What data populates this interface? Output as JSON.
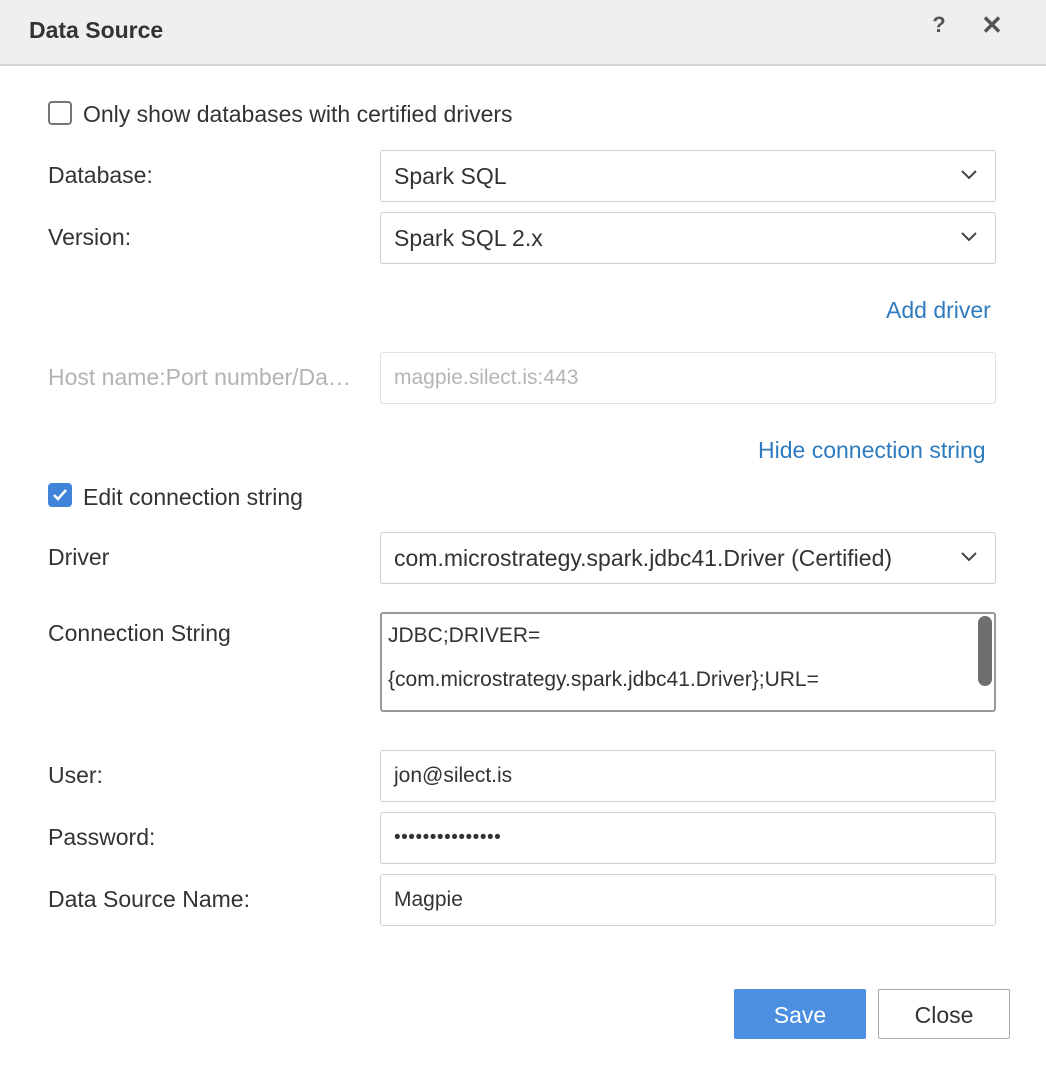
{
  "dialog": {
    "title": "Data Source"
  },
  "certified_only": {
    "label": "Only show databases with certified drivers",
    "checked": false
  },
  "database": {
    "label": "Database:",
    "value": "Spark SQL"
  },
  "version": {
    "label": "Version:",
    "value": "Spark SQL 2.x"
  },
  "add_driver_link": "Add driver",
  "host": {
    "label": "Host name:Port number/Da…",
    "placeholder": "magpie.silect.is:443"
  },
  "hide_connection_link": "Hide connection string",
  "edit_connection": {
    "label": "Edit connection string",
    "checked": true
  },
  "driver": {
    "label": "Driver",
    "value": "com.microstrategy.spark.jdbc41.Driver (Certified)"
  },
  "connection_string": {
    "label": "Connection String",
    "lines": [
      "JDBC;DRIVER=",
      "{com.microstrategy.spark.jdbc41.Driver};URL="
    ]
  },
  "user": {
    "label": "User:",
    "value": "jon@silect.is"
  },
  "password": {
    "label": "Password:",
    "value": "•••••••••••••••"
  },
  "dsn": {
    "label": "Data Source Name:",
    "value": "Magpie"
  },
  "buttons": {
    "save": "Save",
    "close": "Close"
  },
  "colors": {
    "accent": "#4c8fe0",
    "link": "#2e7bbf",
    "titlebar": "#efefef"
  },
  "icons": {
    "help": "?",
    "close": "✕"
  }
}
